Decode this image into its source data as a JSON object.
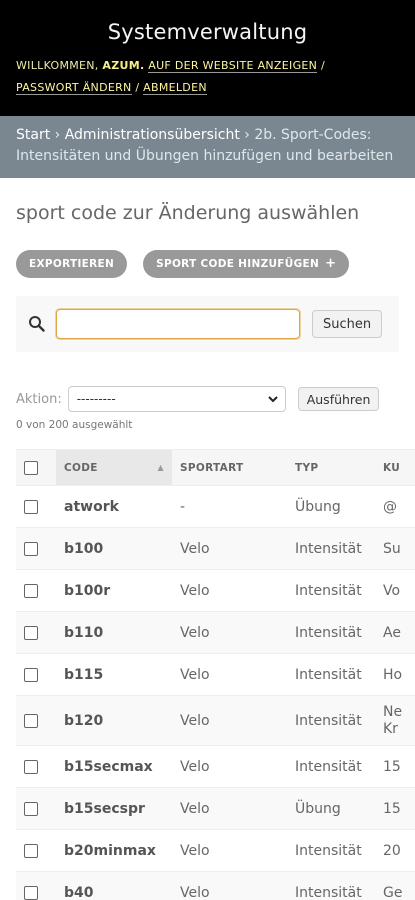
{
  "header": {
    "title": "Systemverwaltung",
    "welcome": "Willkommen,",
    "username": "azum.",
    "view_site": "Auf der Website anzeigen",
    "change_password": "Passwort ändern",
    "logout": "Abmelden",
    "separator": "/"
  },
  "breadcrumbs": {
    "home": "Start",
    "admin": "Administrationsübersicht",
    "app": "2b. Sport-Codes: Intensitäten und Übungen hinzufügen und bearbeiten",
    "separator": "›"
  },
  "page": {
    "title": "sport code zur Änderung auswählen",
    "export_label": "Exportieren",
    "add_label": "Sport code hinzufügen",
    "add_icon": "+"
  },
  "search": {
    "value": "",
    "button": "Suchen"
  },
  "actions": {
    "label": "Aktion:",
    "selected": "---------",
    "run_button": "Ausführen",
    "selection_count": "0 von 200 ausgewählt"
  },
  "table": {
    "headers": {
      "code": "Code",
      "sport": "Sportart",
      "type": "Typ",
      "short": "Ku"
    },
    "rows": [
      {
        "code": "atwork",
        "sport": "-",
        "type": "Übung",
        "short": "@"
      },
      {
        "code": "b100",
        "sport": "Velo",
        "type": "Intensität",
        "short": "Su"
      },
      {
        "code": "b100r",
        "sport": "Velo",
        "type": "Intensität",
        "short": "Vo"
      },
      {
        "code": "b110",
        "sport": "Velo",
        "type": "Intensität",
        "short": "Ae"
      },
      {
        "code": "b115",
        "sport": "Velo",
        "type": "Intensität",
        "short": "Ho"
      },
      {
        "code": "b120",
        "sport": "Velo",
        "type": "Intensität",
        "short": "Ne Kr"
      },
      {
        "code": "b15secmax",
        "sport": "Velo",
        "type": "Intensität",
        "short": "15"
      },
      {
        "code": "b15secspr",
        "sport": "Velo",
        "type": "Übung",
        "short": "15"
      },
      {
        "code": "b20minmax",
        "sport": "Velo",
        "type": "Intensität",
        "short": "20"
      },
      {
        "code": "b40",
        "sport": "Velo",
        "type": "Intensität",
        "short": "Ge"
      }
    ]
  },
  "colors": {
    "header_bg": "#000000",
    "header_link": "#fff6a0",
    "breadcrumb_bg": "#7b8790",
    "pill_bg": "#999999",
    "search_focus": "#dda64a"
  }
}
